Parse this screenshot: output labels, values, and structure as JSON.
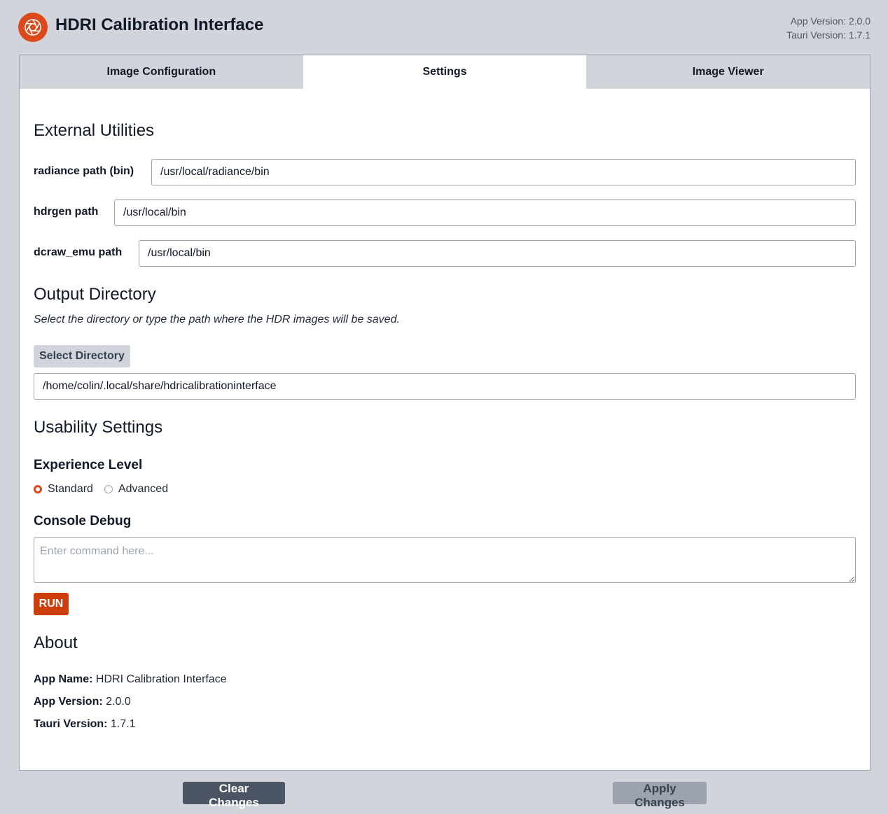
{
  "header": {
    "title": "HDRI Calibration Interface",
    "logo_icon": "camera-aperture-icon",
    "app_version": "App Version: 2.0.0",
    "tauri_version": "Tauri Version: 1.7.1"
  },
  "tabs": [
    {
      "label": "Image Configuration",
      "active": false
    },
    {
      "label": "Settings",
      "active": true
    },
    {
      "label": "Image Viewer",
      "active": false
    }
  ],
  "external_utilities": {
    "title": "External Utilities",
    "radiance": {
      "label": "radiance path (bin)",
      "value": "/usr/local/radiance/bin"
    },
    "hdrgen": {
      "label": "hdrgen path",
      "value": "/usr/local/bin"
    },
    "dcraw": {
      "label": "dcraw_emu path",
      "value": "/usr/local/bin"
    }
  },
  "output_directory": {
    "title": "Output Directory",
    "hint": "Select the directory or type the path where the HDR images will be saved.",
    "select_button": "Select Directory",
    "value": "/home/colin/.local/share/hdricalibrationinterface"
  },
  "usability": {
    "title": "Usability Settings",
    "experience_title": "Experience Level",
    "options": [
      {
        "label": "Standard",
        "checked": true
      },
      {
        "label": "Advanced",
        "checked": false
      }
    ],
    "console_title": "Console Debug",
    "console_placeholder": "Enter command here...",
    "run_button": "RUN"
  },
  "about": {
    "title": "About",
    "app_name_key": "App Name:",
    "app_name_value": "HDRI Calibration Interface",
    "app_version_key": "App Version:",
    "app_version_value": "2.0.0",
    "tauri_version_key": "Tauri Version:",
    "tauri_version_value": "1.7.1"
  },
  "footer": {
    "clear_button": "Clear Changes",
    "apply_button": "Apply Changes"
  },
  "colors": {
    "accent": "#dc4a1c",
    "background": "#d1d5db",
    "panel": "#ffffff"
  }
}
